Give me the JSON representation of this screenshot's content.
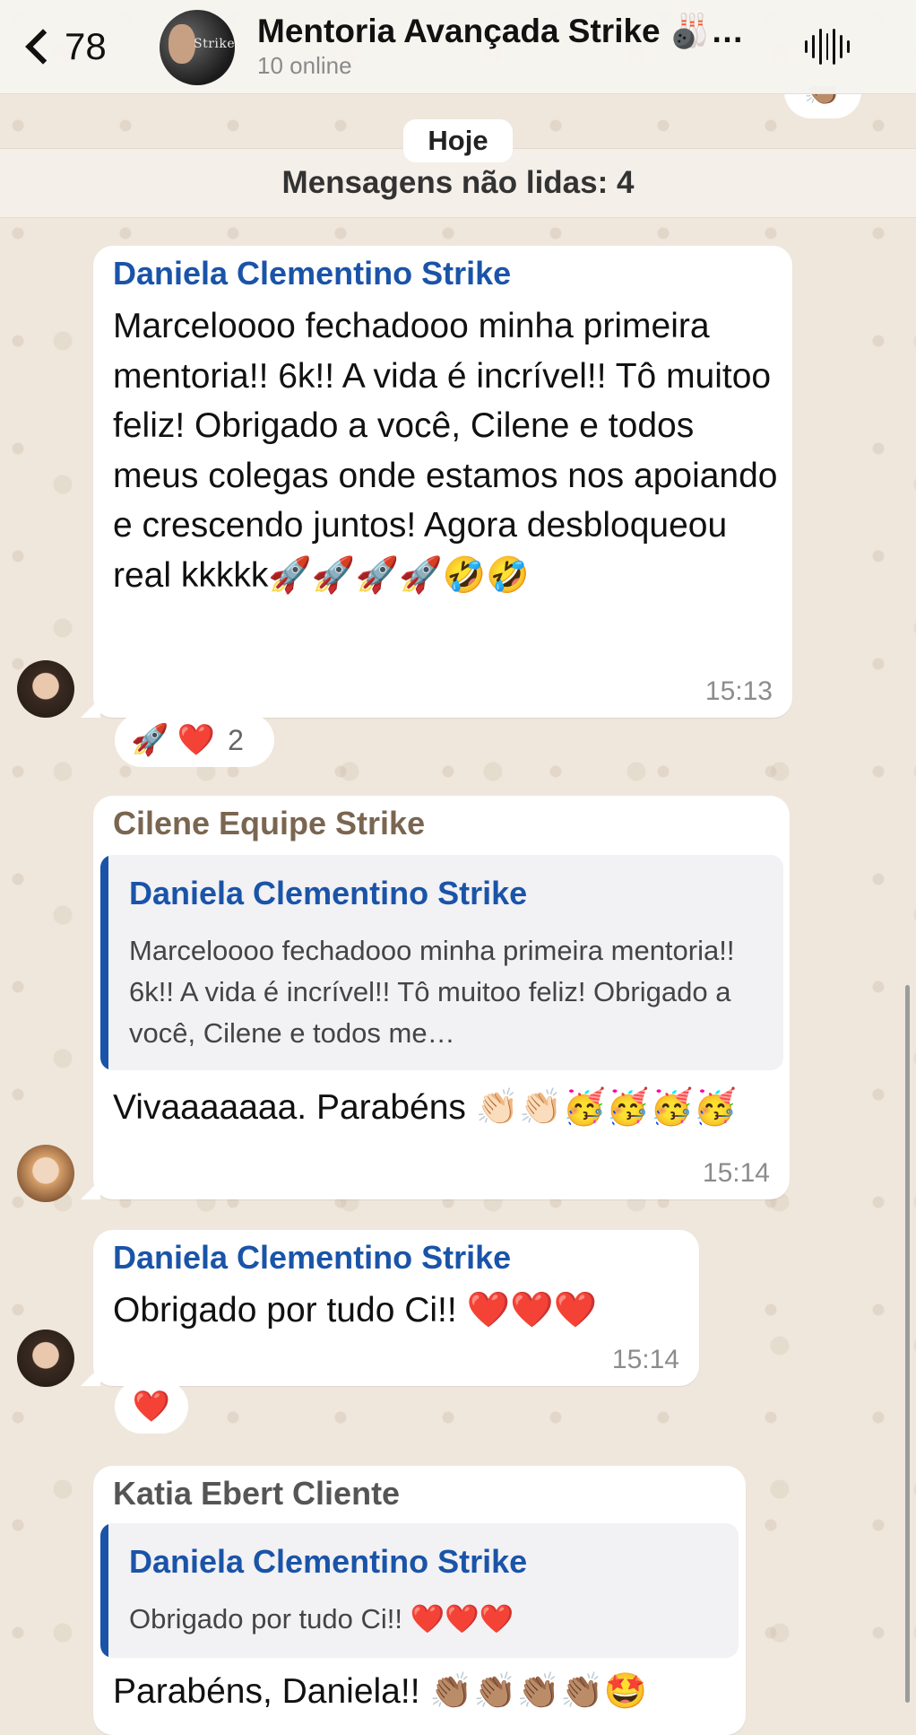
{
  "header": {
    "back_count": "78",
    "group_avatar_text": "Strike",
    "group_name": "Mentoria Avançada Strike 🎳…",
    "status": "10 online"
  },
  "top_reaction": "👏🏽",
  "date_label": "Hoje",
  "unread_label": "Mensagens não lidas: 4",
  "messages": [
    {
      "sender": "Daniela Clementino Strike",
      "sender_color": "#1a54a8",
      "text": "Marceloooo fechadooo minha primeira mentoria!! 6k!! A vida é incrível!! Tô muitoo feliz! Obrigado a você, Cilene e todos meus colegas onde estamos nos apoiando e crescendo juntos! Agora desbloqueou real kkkkk🚀🚀🚀🚀🤣🤣",
      "time": "15:13",
      "reactions": "🚀 ❤️",
      "reaction_count": "2"
    },
    {
      "sender": "Cilene Equipe Strike",
      "sender_color": "#7a6650",
      "quote_sender": "Daniela Clementino Strike",
      "quote_text": "Marceloooo fechadooo minha primeira mentoria!! 6k!! A vida é incrível!! Tô muitoo feliz! Obrigado a você, Cilene e todos me…",
      "text": "Vivaaaaaaa. Parabéns 👏🏻👏🏻🥳🥳🥳🥳",
      "time": "15:14"
    },
    {
      "sender": "Daniela Clementino Strike",
      "sender_color": "#1a54a8",
      "text": "Obrigado por tudo Ci!! ❤️❤️❤️",
      "time": "15:14",
      "reactions": "❤️"
    },
    {
      "sender": "Katia Ebert Cliente",
      "sender_color": "#555555",
      "quote_sender": "Daniela Clementino Strike",
      "quote_text": "Obrigado por tudo Ci!! ❤️❤️❤️",
      "text": "Parabéns, Daniela!! 👏🏽👏🏽👏🏽👏🏽🤩"
    }
  ]
}
